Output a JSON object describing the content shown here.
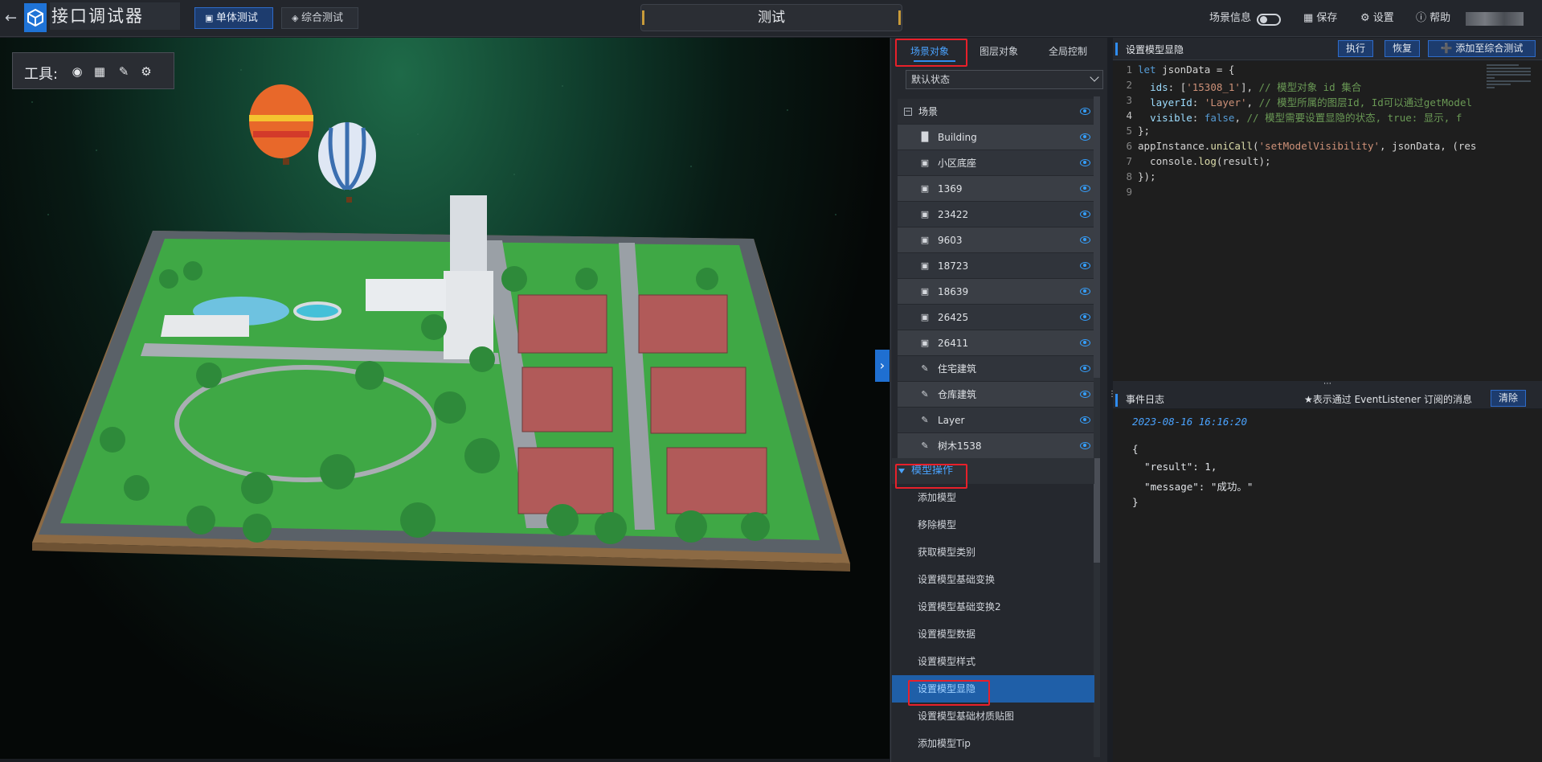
{
  "header": {
    "back_icon": "arrow-left-icon",
    "app_title": "接口调试器",
    "tab_single": "单体测试",
    "tab_combined": "综合测试",
    "center_title": "测试",
    "scene_info": "场景信息",
    "save": "保存",
    "settings": "设置",
    "help": "帮助"
  },
  "toolbox": {
    "label": "工具:",
    "icons": [
      "location-pin-icon",
      "focus-frame-icon",
      "pen-icon",
      "gears-icon"
    ]
  },
  "left_panel": {
    "tabs": [
      "场景对象",
      "图层对象",
      "全局控制"
    ],
    "active_tab": "场景对象",
    "state_select": "默认状态",
    "tree": [
      {
        "label": "场景",
        "type": "root"
      },
      {
        "label": "Building",
        "type": "building"
      },
      {
        "label": "小区底座",
        "type": "cube"
      },
      {
        "label": "1369",
        "type": "cube"
      },
      {
        "label": "23422",
        "type": "cube"
      },
      {
        "label": "9603",
        "type": "cube"
      },
      {
        "label": "18723",
        "type": "cube"
      },
      {
        "label": "18639",
        "type": "cube"
      },
      {
        "label": "26425",
        "type": "cube"
      },
      {
        "label": "26411",
        "type": "cube"
      },
      {
        "label": "住宅建筑",
        "type": "layer"
      },
      {
        "label": "仓库建筑",
        "type": "layer"
      },
      {
        "label": "Layer",
        "type": "layer"
      },
      {
        "label": "树木1538",
        "type": "layer"
      }
    ],
    "section_title": "模型操作",
    "operations": [
      "添加模型",
      "移除模型",
      "获取模型类别",
      "设置模型基础变换",
      "设置模型基础变换2",
      "设置模型数据",
      "设置模型样式",
      "设置模型显隐",
      "设置模型基础材质贴图",
      "添加模型Tip"
    ],
    "selected_operation": "设置模型显隐"
  },
  "editor": {
    "title": "设置模型显隐",
    "run": "执行",
    "reset": "恢复",
    "add_to_combined": "添加至综合测试",
    "line_numbers": [
      "1",
      "2",
      "3",
      "4",
      "5",
      "6",
      "7",
      "8",
      "9"
    ]
  },
  "log": {
    "title": "事件日志",
    "note": "★表示通过 EventListener 订阅的消息",
    "clear": "清除",
    "time": "2023-08-16 16:16:20",
    "lines": [
      "{",
      "  \"result\": 1,",
      "  \"message\": \"成功。\"",
      "}"
    ]
  }
}
